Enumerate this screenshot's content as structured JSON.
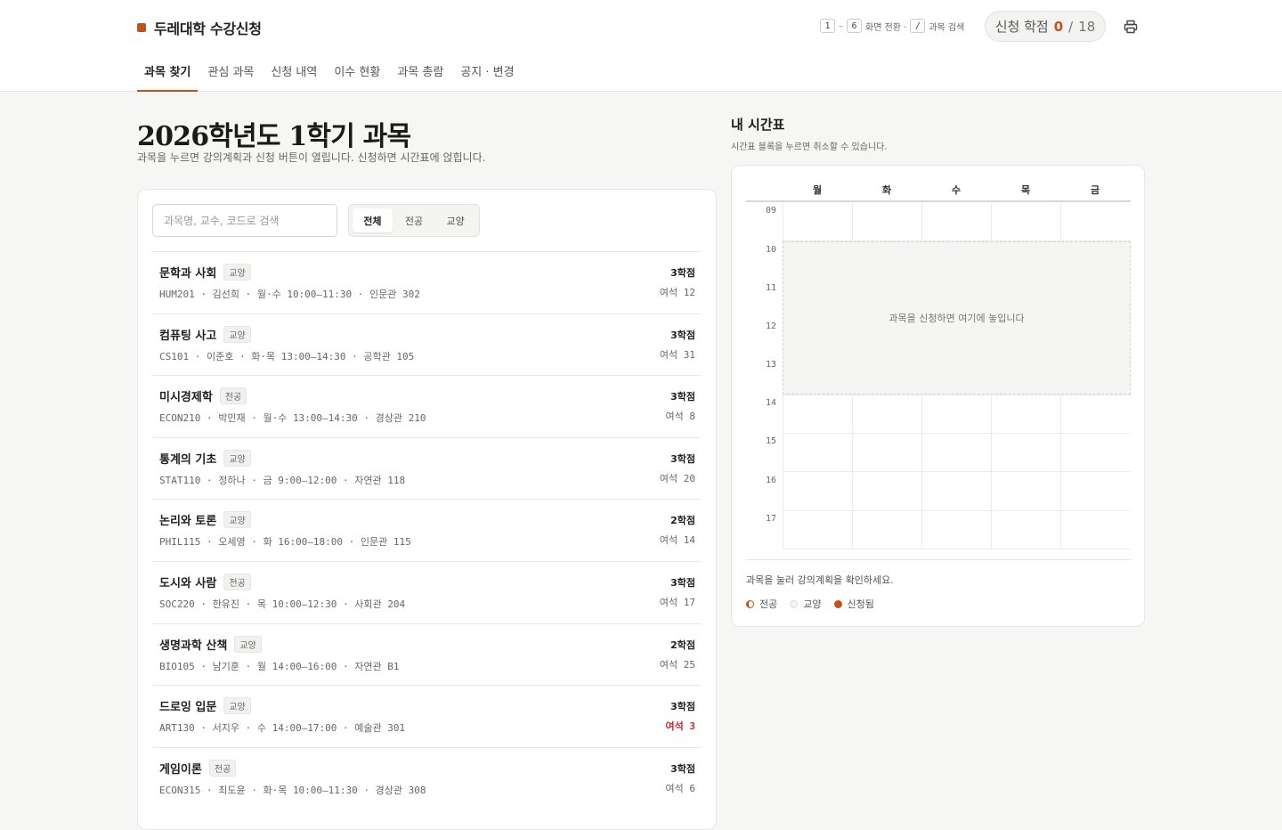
{
  "app": {
    "name": "두레대학 수강신청",
    "brand_color": "#c4501b"
  },
  "hints": {
    "key_start": "1",
    "range_sep": "–",
    "key_end": "6",
    "switch_label": "화면 전환 ·",
    "key_search": "/",
    "search_label": "과목 검색"
  },
  "credits": {
    "label": "신청 학점",
    "current": "0",
    "slash": "/",
    "max": "18"
  },
  "tabs": [
    {
      "label": "과목 찾기",
      "active": true
    },
    {
      "label": "관심 과목"
    },
    {
      "label": "신청 내역"
    },
    {
      "label": "이수 현황"
    },
    {
      "label": "과목 총람"
    },
    {
      "label": "공지 · 변경"
    }
  ],
  "main": {
    "title": "2026학년도 1학기 과목",
    "subtitle": "과목을 누르면 강의계획과 신청 버튼이 열립니다. 신청하면 시간표에 얹힙니다.",
    "search_placeholder": "과목명, 교수, 코드로 검색",
    "filters": [
      {
        "label": "전체",
        "active": true
      },
      {
        "label": "전공"
      },
      {
        "label": "교양"
      }
    ]
  },
  "courses": [
    {
      "title": "문학과 사회",
      "tag": "교양",
      "meta": "HUM201 · 김선희 · 월·수 10:00–11:30 · 인문관 302",
      "credits": "3학점",
      "seats": "여석 12"
    },
    {
      "title": "컴퓨팅 사고",
      "tag": "교양",
      "meta": "CS101 · 이준호 · 화·목 13:00–14:30 · 공학관 105",
      "credits": "3학점",
      "seats": "여석 31"
    },
    {
      "title": "미시경제학",
      "tag": "전공",
      "meta": "ECON210 · 박민재 · 월·수 13:00–14:30 · 경상관 210",
      "credits": "3학점",
      "seats": "여석 8"
    },
    {
      "title": "통계의 기초",
      "tag": "교양",
      "meta": "STAT110 · 정하나 · 금 9:00–12:00 · 자연관 118",
      "credits": "3학점",
      "seats": "여석 20"
    },
    {
      "title": "논리와 토론",
      "tag": "교양",
      "meta": "PHIL115 · 오세영 · 화 16:00–18:00 · 인문관 115",
      "credits": "2학점",
      "seats": "여석 14"
    },
    {
      "title": "도시와 사람",
      "tag": "전공",
      "meta": "SOC220 · 한유진 · 목 10:00–12:30 · 사회관 204",
      "credits": "3학점",
      "seats": "여석 17"
    },
    {
      "title": "생명과학 산책",
      "tag": "교양",
      "meta": "BIO105 · 남기훈 · 월 14:00–16:00 · 자연관 B1",
      "credits": "2학점",
      "seats": "여석 25"
    },
    {
      "title": "드로잉 입문",
      "tag": "교양",
      "meta": "ART130 · 서지우 · 수 14:00–17:00 · 예술관 301",
      "credits": "3학점",
      "seats": "여석 3",
      "low": true
    },
    {
      "title": "게임이론",
      "tag": "전공",
      "meta": "ECON315 · 최도윤 · 화·목 10:00–11:30 · 경상관 308",
      "credits": "3학점",
      "seats": "여석 6"
    }
  ],
  "timetable": {
    "title": "내 시간표",
    "subtitle": "시간표 블록을 누르면 취소할 수 있습니다.",
    "days": [
      "월",
      "화",
      "수",
      "목",
      "금"
    ],
    "hours": [
      "09",
      "10",
      "11",
      "12",
      "13",
      "14",
      "15",
      "16",
      "17"
    ],
    "empty_text": "과목을 신청하면 여기에 놓입니다",
    "hint": "과목을 눌러 강의계획을 확인하세요.",
    "legend": {
      "major": "전공",
      "general": "교양",
      "enrolled": "신청됨"
    }
  },
  "icons": {
    "print": "printer-icon"
  }
}
